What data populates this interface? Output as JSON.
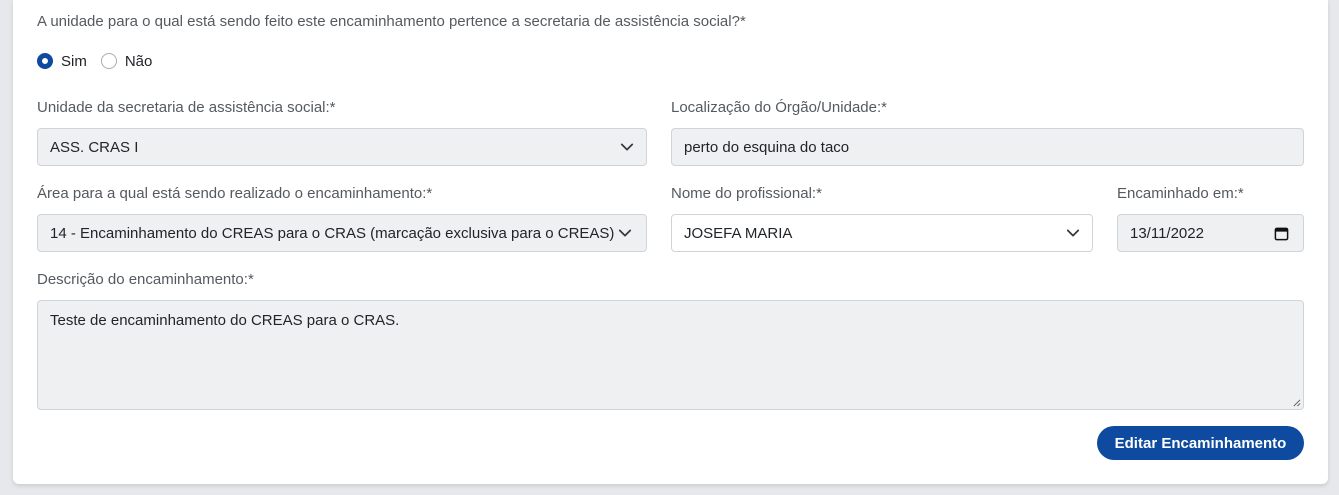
{
  "form": {
    "question": "A unidade para o qual está sendo feito este encaminhamento pertence a secretaria de assistência social?*",
    "radio_options": [
      {
        "label": "Sim",
        "checked": true
      },
      {
        "label": "Não",
        "checked": false
      }
    ],
    "unidade": {
      "label": "Unidade da secretaria de assistência social:*",
      "value": "ASS. CRAS I"
    },
    "localizacao": {
      "label": "Localização do Órgão/Unidade:*",
      "value": "perto do esquina do taco"
    },
    "area": {
      "label": "Área para a qual está sendo realizado o encaminhamento:*",
      "value": "14 - Encaminhamento do CREAS para o CRAS (marcação exclusiva para o CREAS)"
    },
    "profissional": {
      "label": "Nome do profissional:*",
      "value": "JOSEFA MARIA"
    },
    "encaminhado_em": {
      "label": "Encaminhado em:*",
      "value": "13/11/2022"
    },
    "descricao": {
      "label": "Descrição do encaminhamento:*",
      "value": "Teste de encaminhamento do CREAS para o CRAS."
    },
    "submit_label": "Editar Encaminhamento"
  },
  "colors": {
    "accent": "#0d4aa0",
    "disabled_field_bg": "#eff0f2",
    "label_text": "#555a60",
    "page_bg": "#e7e8ec"
  },
  "icons": {
    "select_arrow": "chevron-down-icon",
    "date_picker": "calendar-icon",
    "textarea_resize": "resize-handle-icon"
  }
}
